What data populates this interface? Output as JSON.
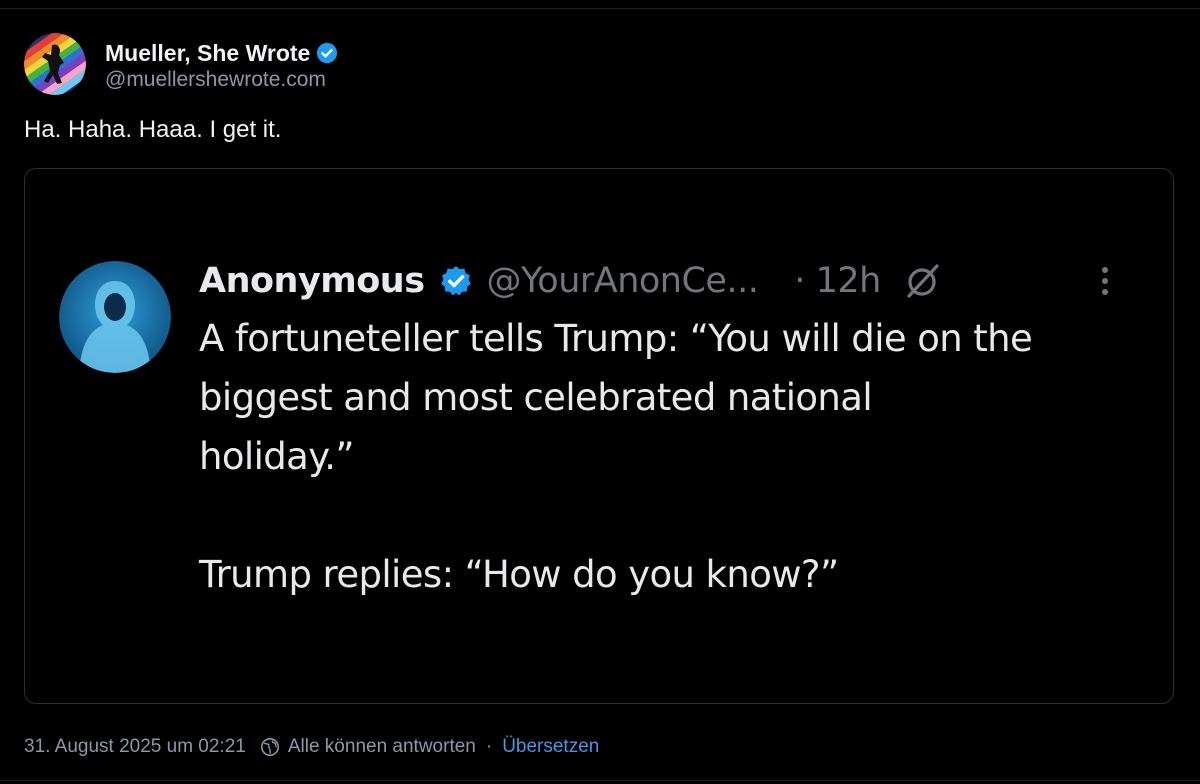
{
  "post": {
    "author": {
      "display_name": "Mueller, She Wrote",
      "handle": "@muellershewrote.com",
      "verified": true
    },
    "text": "Ha. Haha. Haaa. I get it.",
    "embed": {
      "author": {
        "display_name": "Anonymous",
        "handle": "@YourAnonCe...",
        "time": "· 12h",
        "verified": true
      },
      "text_lines": [
        "A fortuneteller tells Trump: “You will die on the",
        "biggest and most celebrated national",
        "holiday.”",
        "",
        "Trump replies: “How do you know?”"
      ]
    },
    "footer": {
      "timestamp": "31. August 2025 um 02:21",
      "reply_setting": "Alle können antworten",
      "separator": "·",
      "translate_label": "Übersetzen"
    }
  },
  "colors": {
    "background": "#000000",
    "text_primary": "#f1f3f5",
    "text_secondary": "#8b98a5",
    "link": "#4e94e0",
    "verified": "#1d9bf0",
    "card_border": "#2a2f35"
  },
  "icons": {
    "verified": "verified-badge-icon",
    "reply_setting": "earth-icon",
    "grok": "grok-icon",
    "more": "more-vertical-icon"
  }
}
